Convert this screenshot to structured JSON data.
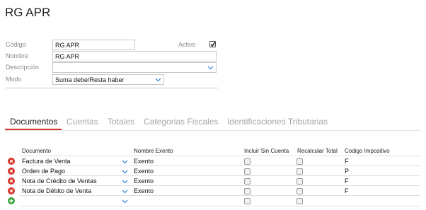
{
  "page": {
    "title": "RG APR"
  },
  "form": {
    "codigo": {
      "label": "Código",
      "value": "RG APR"
    },
    "activo": {
      "label": "Activo",
      "checked": true
    },
    "nombre": {
      "label": "Nombre",
      "value": "RG APR"
    },
    "descripcion": {
      "label": "Descripción",
      "value": ""
    },
    "modo": {
      "label": "Modo",
      "value": "Suma debe/Resta haber"
    }
  },
  "tabs": [
    {
      "label": "Documentos",
      "active": true
    },
    {
      "label": "Cuentas",
      "active": false
    },
    {
      "label": "Totales",
      "active": false
    },
    {
      "label": "Categorias Fiscales",
      "active": false
    },
    {
      "label": "Identificaciones Tributarias",
      "active": false
    }
  ],
  "grid": {
    "columns": [
      "Documento",
      "Nombre Exento",
      "Incluir Sin Cuenta",
      "Recalcular Total",
      "Codigo Impositivo"
    ],
    "rows": [
      {
        "documento": "Factura de Venta",
        "nombre_exento": "Exento",
        "incluir_sin_cuenta": false,
        "recalcular_total": false,
        "codigo_impositivo": "F"
      },
      {
        "documento": "Orden de Pago",
        "nombre_exento": "Exento",
        "incluir_sin_cuenta": false,
        "recalcular_total": false,
        "codigo_impositivo": "P"
      },
      {
        "documento": "Nota de Crédito de Ventas",
        "nombre_exento": "Exento",
        "incluir_sin_cuenta": false,
        "recalcular_total": false,
        "codigo_impositivo": "F"
      },
      {
        "documento": "Nota de Débito de Venta",
        "nombre_exento": "Exento",
        "incluir_sin_cuenta": false,
        "recalcular_total": false,
        "codigo_impositivo": "F"
      }
    ],
    "new_row": {
      "incluir_sin_cuenta": false,
      "recalcular_total": false
    }
  },
  "colors": {
    "accent": "#d9322a",
    "delete": "#d9322a",
    "add": "#3aa53a",
    "chevron": "#2a7fd4"
  },
  "icons": {
    "delete": "delete-icon",
    "add": "add-icon",
    "dropdown": "chevron-down-icon",
    "check": "checkmark-icon"
  }
}
